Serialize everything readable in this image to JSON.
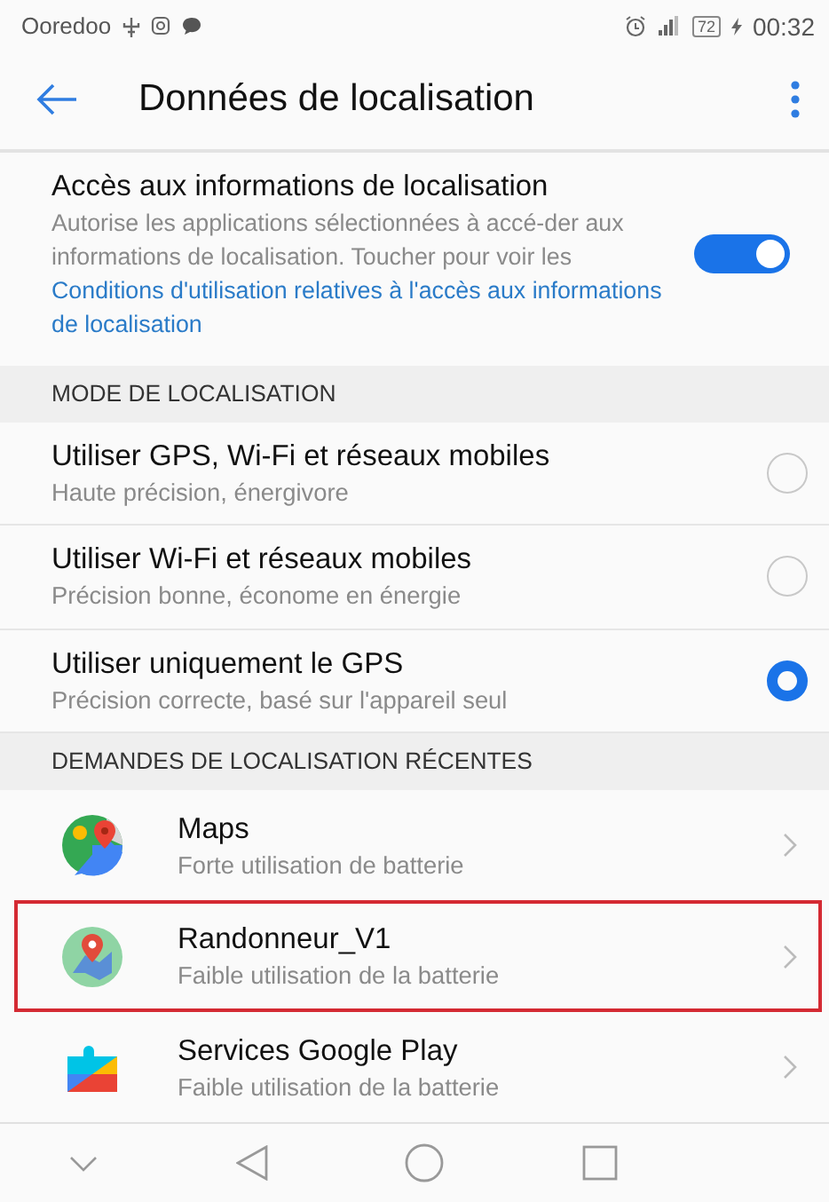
{
  "status_bar": {
    "carrier": "Ooredoo",
    "battery": "72",
    "time": "00:32"
  },
  "toolbar": {
    "title": "Données de localisation"
  },
  "access": {
    "title": "Accès aux informations de localisation",
    "description": "Autorise les applications sélectionnées à accé-der aux informations de localisation. Toucher pour voir les ",
    "link": "Conditions d'utilisation relatives à l'accès aux informations de localisation",
    "on": true
  },
  "mode_section": {
    "header": "MODE DE LOCALISATION",
    "options": [
      {
        "title": "Utiliser GPS, Wi-Fi et réseaux mobiles",
        "subtitle": "Haute précision, énergivore",
        "selected": false
      },
      {
        "title": "Utiliser Wi-Fi et réseaux mobiles",
        "subtitle": "Précision bonne, économe en énergie",
        "selected": false
      },
      {
        "title": "Utiliser uniquement le GPS",
        "subtitle": "Précision correcte, basé sur l'appareil seul",
        "selected": true
      }
    ]
  },
  "recent_section": {
    "header": "DEMANDES DE LOCALISATION RÉCENTES",
    "apps": [
      {
        "kind": "maps",
        "name": "Maps",
        "usage": "Forte utilisation de batterie",
        "highlighted": false
      },
      {
        "kind": "pin",
        "name": "Randonneur_V1",
        "usage": "Faible utilisation de la batterie",
        "highlighted": true
      },
      {
        "kind": "puzzle",
        "name": "Services Google Play",
        "usage": "Faible utilisation de la batterie",
        "highlighted": false
      }
    ]
  }
}
